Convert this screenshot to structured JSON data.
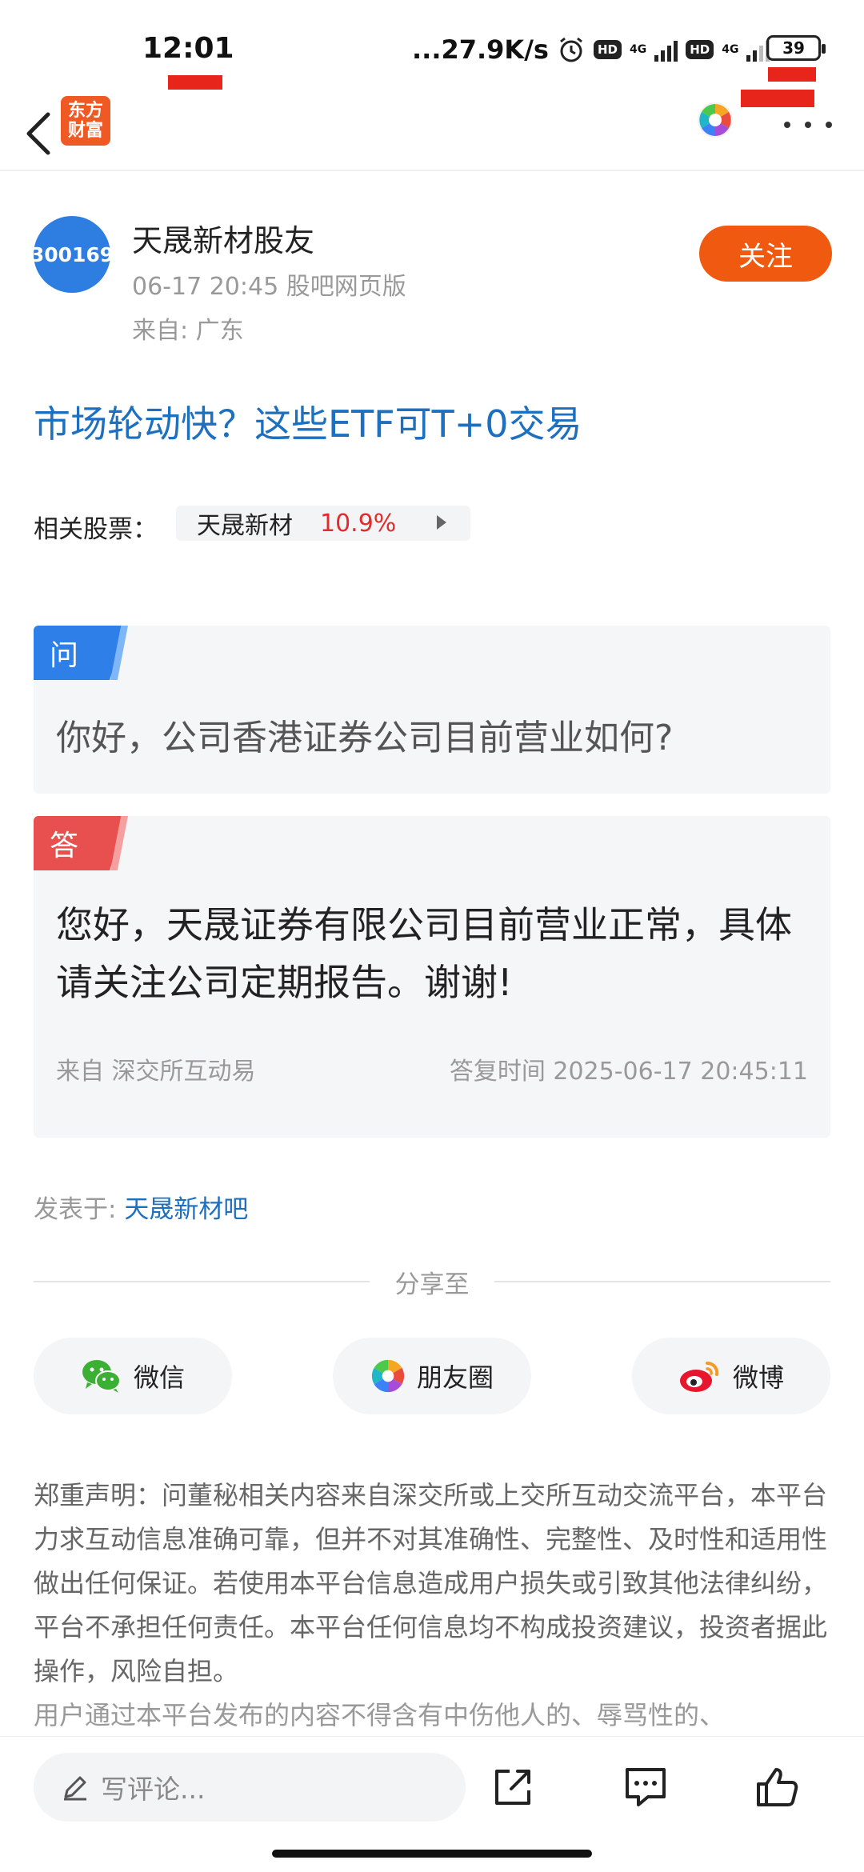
{
  "status_bar": {
    "time": "12:01",
    "network_speed": "...27.9K/s",
    "hd_badge_1": "HD",
    "hd_badge_2": "HD",
    "network_type_1": "4G",
    "network_type_2": "4G",
    "battery_level": "39"
  },
  "nav": {
    "logo_text_line1": "东方",
    "logo_text_line2": "财富"
  },
  "author": {
    "avatar_text": "300169",
    "name": "天晟新材股友",
    "meta": "06-17 20:45 股吧网页版",
    "location": "来自: 广东",
    "follow_label": "关注"
  },
  "post": {
    "title": "市场轮动快？这些ETF可T+0交易",
    "related_label": "相关股票：",
    "stock_name": "天晟新材",
    "stock_change": "10.9%"
  },
  "question": {
    "tag": "问",
    "text": "你好，公司香港证券公司目前营业如何?"
  },
  "answer": {
    "tag": "答",
    "text": "您好，天晟证券有限公司目前营业正常，具体请关注公司定期报告。谢谢!",
    "source": "来自 深交所互动易",
    "reply_time": "答复时间 2025-06-17 20:45:11"
  },
  "posted_in": {
    "label": "发表于: ",
    "bar_name": "天晟新材吧"
  },
  "share": {
    "label": "分享至",
    "wechat": "微信",
    "moments": "朋友圈",
    "weibo": "微博"
  },
  "disclaimer": {
    "para1": "郑重声明：问董秘相关内容来自深交所或上交所互动交流平台，本平台力求互动信息准确可靠，但并不对其准确性、完整性、及时性和适用性做出任何保证。若使用本平台信息造成用户损失或引致其他法律纠纷，平台不承担任何责任。本平台任何信息均不构成投资建议，投资者据此操作，风险自担。",
    "para2": "用户通过本平台发布的内容不得含有中伤他人的、辱骂性的、"
  },
  "bottom_bar": {
    "comment_placeholder": "写评论..."
  },
  "colors": {
    "brand_orange": "#ef5a24",
    "link_blue": "#1d6fbf",
    "question_blue": "#2f7fe8",
    "answer_red": "#e85050",
    "stock_up_red": "#e22b2b"
  }
}
